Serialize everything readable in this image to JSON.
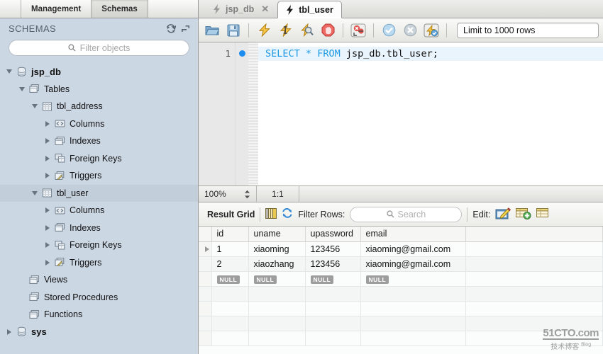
{
  "left_panel": {
    "tabs": [
      {
        "label": "Management",
        "active": false
      },
      {
        "label": "Schemas",
        "active": true
      }
    ],
    "section_title": "SCHEMAS",
    "header_icons": [
      {
        "name": "refresh-icon"
      },
      {
        "name": "collapse-all-icon"
      }
    ],
    "filter": {
      "placeholder": "Filter objects",
      "value": "",
      "icon": "search-icon"
    },
    "tree": [
      {
        "label": "jsp_db",
        "indent": 0,
        "twisty": "down",
        "icon": "database-icon",
        "bold": true,
        "selected": false
      },
      {
        "label": "Tables",
        "indent": 1,
        "twisty": "down",
        "icon": "folder-tables-icon",
        "bold": false,
        "selected": false
      },
      {
        "label": "tbl_address",
        "indent": 2,
        "twisty": "down",
        "icon": "table-icon",
        "bold": false,
        "selected": false
      },
      {
        "label": "Columns",
        "indent": 3,
        "twisty": "right",
        "icon": "columns-icon",
        "bold": false,
        "selected": false
      },
      {
        "label": "Indexes",
        "indent": 3,
        "twisty": "right",
        "icon": "indexes-icon",
        "bold": false,
        "selected": false
      },
      {
        "label": "Foreign Keys",
        "indent": 3,
        "twisty": "right",
        "icon": "foreign-keys-icon",
        "bold": false,
        "selected": false
      },
      {
        "label": "Triggers",
        "indent": 3,
        "twisty": "right",
        "icon": "triggers-icon",
        "bold": false,
        "selected": false
      },
      {
        "label": "tbl_user",
        "indent": 2,
        "twisty": "down",
        "icon": "table-icon",
        "bold": false,
        "selected": true
      },
      {
        "label": "Columns",
        "indent": 3,
        "twisty": "right",
        "icon": "columns-icon",
        "bold": false,
        "selected": false
      },
      {
        "label": "Indexes",
        "indent": 3,
        "twisty": "right",
        "icon": "indexes-icon",
        "bold": false,
        "selected": false
      },
      {
        "label": "Foreign Keys",
        "indent": 3,
        "twisty": "right",
        "icon": "foreign-keys-icon",
        "bold": false,
        "selected": false
      },
      {
        "label": "Triggers",
        "indent": 3,
        "twisty": "right",
        "icon": "triggers-icon",
        "bold": false,
        "selected": false
      },
      {
        "label": "Views",
        "indent": 1,
        "twisty": "none",
        "icon": "folder-views-icon",
        "bold": false,
        "selected": false
      },
      {
        "label": "Stored Procedures",
        "indent": 1,
        "twisty": "none",
        "icon": "folder-procs-icon",
        "bold": false,
        "selected": false
      },
      {
        "label": "Functions",
        "indent": 1,
        "twisty": "none",
        "icon": "folder-funcs-icon",
        "bold": false,
        "selected": false
      },
      {
        "label": "sys",
        "indent": 0,
        "twisty": "right",
        "icon": "database-icon",
        "bold": true,
        "selected": false
      }
    ]
  },
  "editor_tabs": [
    {
      "label": "jsp_db",
      "icon": "lightning-icon",
      "active": false,
      "closable": true
    },
    {
      "label": "tbl_user",
      "icon": "lightning-icon",
      "active": true,
      "closable": false
    }
  ],
  "sql_toolbar": {
    "buttons": [
      {
        "name": "open-sql-script-button",
        "icon": "folder-open-icon"
      },
      {
        "name": "save-sql-script-button",
        "icon": "floppy-save-icon"
      },
      {
        "name": "execute-statement-button",
        "icon": "lightning-execute-icon"
      },
      {
        "name": "execute-current-button",
        "icon": "lightning-cursor-icon"
      },
      {
        "name": "explain-query-button",
        "icon": "lightning-magnifier-icon"
      },
      {
        "name": "stop-execution-button",
        "icon": "stop-hand-icon"
      },
      {
        "name": "toggle-stop-on-error-button",
        "icon": "stop-on-error-icon"
      },
      {
        "name": "commit-button",
        "icon": "commit-check-icon"
      },
      {
        "name": "rollback-button",
        "icon": "rollback-x-icon"
      },
      {
        "name": "autocommit-toggle-button",
        "icon": "autocommit-icon"
      }
    ],
    "limit_select": {
      "value": "Limit to 1000 rows"
    }
  },
  "sql_editor": {
    "line_number": "1",
    "marker": "breakpoint-dot",
    "tokens": {
      "kw_select": "SELECT",
      "star": "*",
      "kw_from": "FROM",
      "table_ref": "jsp_db.tbl_user",
      "semicolon": ";"
    },
    "full_text": "SELECT * FROM jsp_db.tbl_user;"
  },
  "editor_status": {
    "zoom": "100%",
    "cursor_position": "1:1"
  },
  "result_bar": {
    "title": "Result Grid",
    "grid_view_icon": "grid-view-icon",
    "refresh_icon": "refresh-icon",
    "filter_label": "Filter Rows:",
    "search": {
      "placeholder": "Search",
      "value": "",
      "icon": "search-icon"
    },
    "edit_label": "Edit:",
    "edit_buttons": [
      {
        "name": "edit-row-button",
        "icon": "pencil-edit-icon"
      },
      {
        "name": "insert-row-button",
        "icon": "table-add-row-icon"
      },
      {
        "name": "delete-row-button",
        "icon": "table-delete-row-icon"
      }
    ]
  },
  "result_grid": {
    "columns": [
      "id",
      "uname",
      "upassword",
      "email"
    ],
    "rows": [
      {
        "selected": true,
        "cells": [
          "1",
          "xiaoming",
          "123456",
          "xiaoming@gmail.com"
        ],
        "null_row": false
      },
      {
        "selected": false,
        "cells": [
          "2",
          "xiaozhang",
          "123456",
          "xiaoming@gmail.com"
        ],
        "null_row": false
      },
      {
        "selected": false,
        "cells": [
          "NULL",
          "NULL",
          "NULL",
          "NULL"
        ],
        "null_row": true
      }
    ],
    "empty_row_count": 4
  },
  "watermark": {
    "line1": "51CTO.com",
    "line2": "技术博客",
    "sup": "Blog"
  },
  "colors": {
    "sidebar_bg": "#ccd7e4",
    "sidebar_selected": "#c3cedb",
    "sql_keyword": "#1d9ae3",
    "code_line_highlight": "#eaf4fc",
    "marker_dot": "#1b8cf0",
    "null_badge": "#9d9d9d",
    "grid_bg": "#fbfdfd"
  }
}
